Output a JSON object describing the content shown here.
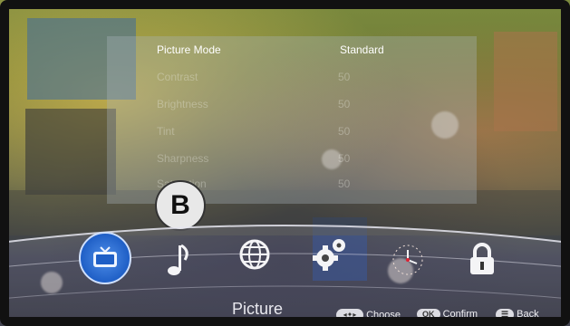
{
  "menu": {
    "title": "Picture Mode",
    "value": "Standard",
    "items": [
      {
        "label": "Contrast",
        "value": "50"
      },
      {
        "label": "Brightness",
        "value": "50"
      },
      {
        "label": "Tint",
        "value": "50"
      },
      {
        "label": "Sharpness",
        "value": "50"
      },
      {
        "label": "Saturation",
        "value": "50"
      }
    ]
  },
  "badge": {
    "label": "B"
  },
  "dock": {
    "selected_caption": "Picture",
    "icons": [
      "tv-icon",
      "music-note-icon",
      "globe-icon",
      "gear-icon",
      "clock-icon",
      "lock-icon"
    ]
  },
  "hints": {
    "choose_label": "Choose",
    "confirm_pill": "OK",
    "confirm_label": "Confirm",
    "back_label": "Back"
  },
  "colors": {
    "selected_icon": "#1f5fc6",
    "text": "#ffffff"
  }
}
